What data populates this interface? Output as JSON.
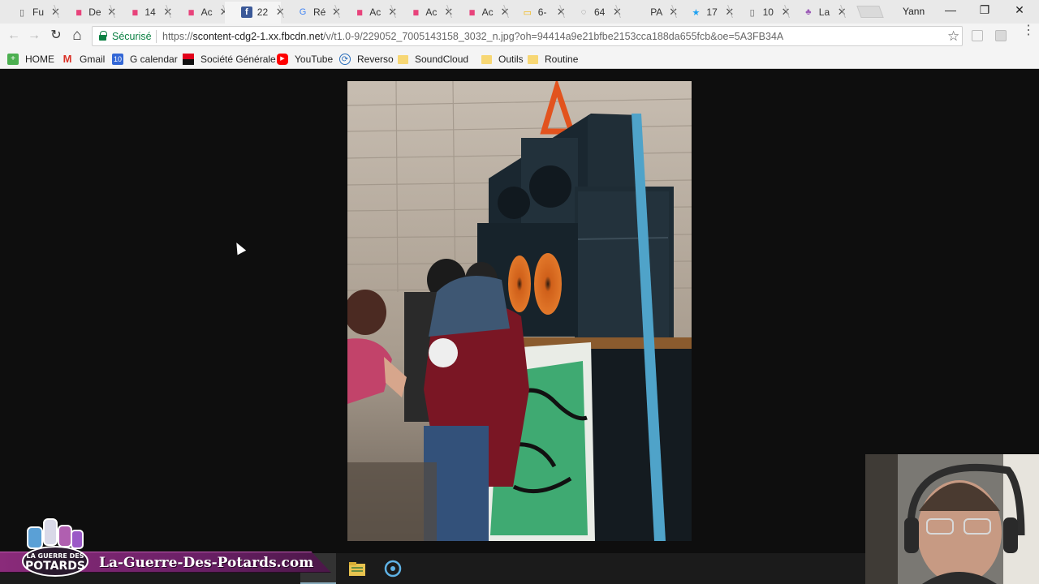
{
  "tabs": [
    {
      "title": "Fu",
      "icon": "document-icon"
    },
    {
      "title": "De",
      "icon": "analytics-icon"
    },
    {
      "title": "14",
      "icon": "analytics-icon"
    },
    {
      "title": "Ac",
      "icon": "analytics-icon"
    },
    {
      "title": "22",
      "icon": "facebook-icon",
      "active": true
    },
    {
      "title": "Ré",
      "icon": "google-icon"
    },
    {
      "title": "Ac",
      "icon": "analytics-icon"
    },
    {
      "title": "Ac",
      "icon": "analytics-icon"
    },
    {
      "title": "Ac",
      "icon": "analytics-icon"
    },
    {
      "title": "6-",
      "icon": "slides-icon"
    },
    {
      "title": "64",
      "icon": "loading-icon"
    },
    {
      "title": "PA",
      "icon": "blank-icon"
    },
    {
      "title": "17",
      "icon": "bookmark-star-icon"
    },
    {
      "title": "10",
      "icon": "document-icon"
    },
    {
      "title": "La",
      "icon": "site-icon"
    }
  ],
  "tab_close_glyph": "✕",
  "profile_name": "Yann",
  "window_controls": {
    "minimize": "—",
    "restore": "❐",
    "close": "✕"
  },
  "toolbar": {
    "back": "←",
    "forward": "→",
    "reload": "↻",
    "home": "⌂",
    "secure_label": "Sécurisé",
    "url_scheme": "https://",
    "url_host": "scontent-cdg2-1.xx.fbcdn.net",
    "url_path": "/v/t1.0-9/229052_7005143158_3032_n.jpg?oh=94414a9e21bfbe2153cca188da655fcb&oe=5A3FB34A",
    "star": "☆",
    "menu": "⋮"
  },
  "bookmarks": [
    {
      "label": "HOME",
      "icon": "plus-square-icon",
      "color": "#4caf50"
    },
    {
      "label": "Gmail",
      "icon": "gmail-icon",
      "color": "#d93025"
    },
    {
      "label": "G calendar",
      "icon": "calendar-icon",
      "color": "#3367d6"
    },
    {
      "label": "Société Générale",
      "icon": "bank-icon",
      "color": "#e2001a"
    },
    {
      "label": "YouTube",
      "icon": "youtube-icon",
      "color": "#ff0000"
    },
    {
      "label": "Reverso",
      "icon": "reverso-icon",
      "color": "#2a6ebb"
    },
    {
      "label": "SoundCloud",
      "icon": "folder-icon",
      "color": "#f7d774"
    },
    {
      "label": "Outils",
      "icon": "folder-icon",
      "color": "#f7d774"
    },
    {
      "label": "Routine",
      "icon": "folder-icon",
      "color": "#f7d774"
    }
  ],
  "calendar_day": "10",
  "watermark": {
    "site": "La-Guerre-Des-Potards.com",
    "logo_lines": [
      "LA GUERRE DES",
      "POTARDS"
    ]
  },
  "colors": {
    "page_bg": "#0e0e0e",
    "secure_green": "#0b8043",
    "banner_purple": "#8a2b7a",
    "facebook_blue": "#3b5998"
  }
}
